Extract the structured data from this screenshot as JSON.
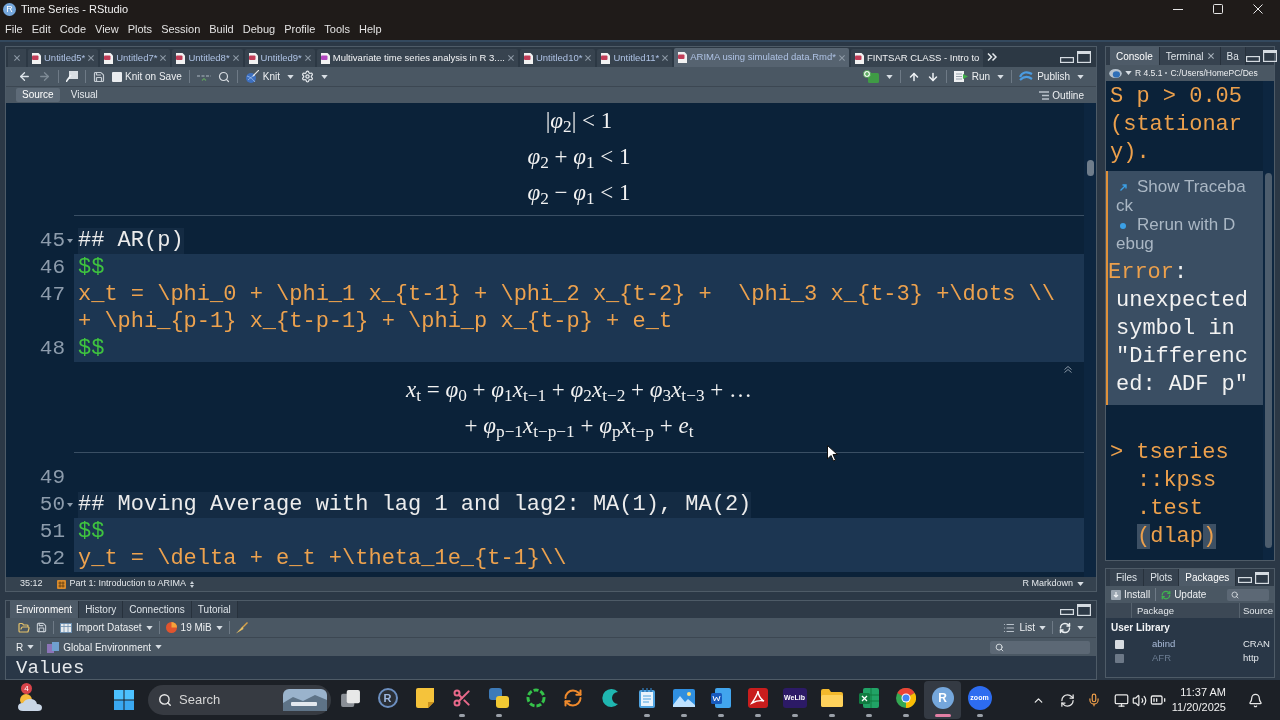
{
  "window": {
    "logo_letter": "R",
    "title": "Time Series - RStudio"
  },
  "menu": [
    "File",
    "Edit",
    "Code",
    "View",
    "Plots",
    "Session",
    "Build",
    "Debug",
    "Profile",
    "Tools",
    "Help"
  ],
  "editor": {
    "tabs": [
      {
        "label": "Untitled5*",
        "kind": "rmd",
        "modified": true,
        "closable": true,
        "selected": false
      },
      {
        "label": "Untitled7*",
        "kind": "rmd",
        "modified": true,
        "closable": true,
        "selected": false
      },
      {
        "label": "Untitled8*",
        "kind": "rmd",
        "modified": true,
        "closable": true,
        "selected": false
      },
      {
        "label": "Untitled9*",
        "kind": "rmd",
        "modified": true,
        "closable": true,
        "selected": false
      },
      {
        "label": "Multivariate time series analysis in R 3....",
        "kind": "other",
        "modified": false,
        "closable": true,
        "selected": false
      },
      {
        "label": "Untitled10*",
        "kind": "rmd",
        "modified": true,
        "closable": true,
        "selected": false
      },
      {
        "label": "Untitled11*",
        "kind": "rmd",
        "modified": true,
        "closable": true,
        "selected": false
      },
      {
        "label": "ARIMA using simulated data.Rmd*",
        "kind": "rmd",
        "modified": true,
        "closable": true,
        "selected": true
      },
      {
        "label": "FINTSAR CLASS - Intro to",
        "kind": "rmd",
        "modified": false,
        "closable": false,
        "selected": false
      }
    ],
    "toolbar": {
      "knit_on_save": {
        "label": "Knit on Save",
        "checked": false
      },
      "knit": "Knit",
      "run": "Run",
      "publish": "Publish"
    },
    "modes": [
      {
        "label": "Source",
        "selected": true
      },
      {
        "label": "Visual",
        "selected": false
      }
    ],
    "outline": "Outline",
    "lines": [
      {
        "kind": "math",
        "rows": [
          "|*φ*$_{2}$| < 1",
          "*φ*$_{2}$ + *φ*$_{1}$ < 1",
          "*φ*$_{2}$ − *φ*$_{1}$ < 1"
        ],
        "collapse_button": false
      },
      {
        "kind": "heading",
        "number": "45",
        "rows": [
          "## AR(p)"
        ],
        "foldable": true
      },
      {
        "kind": "delimiter",
        "number": "46",
        "rows": [
          "$$"
        ]
      },
      {
        "kind": "code",
        "number": "47",
        "rows": [
          "x_t = \\phi_0 + \\phi_1 x_{t-1} + \\phi_2 x_{t-2} +  \\phi_3 x_{t-3} +\\dots \\\\",
          "+ \\phi_{p-1} x_{t-p-1} + \\phi_p x_{t-p} + e_t"
        ]
      },
      {
        "kind": "delimiter",
        "number": "48",
        "rows": [
          "$$"
        ]
      },
      {
        "kind": "math",
        "rows": [
          "*x*$_{t}$ = *φ*$_{0}$ + *φ*$_{1}$*x*$_{t−1}$ + *φ*$_{2}$*x*$_{t−2}$ + *φ*$_{3}$*x*$_{t−3}$ + …",
          "+ *φ*$_{p−1}$*x*$_{t−p−1}$ + *φ*$_{p}$*x*$_{t−p}$ + *e*$_{t}$"
        ],
        "collapse_button": true
      },
      {
        "kind": "blank",
        "number": "49"
      },
      {
        "kind": "heading",
        "number": "50",
        "rows": [
          "## Moving Average with lag 1 and lag2: MA(1), MA(2)"
        ],
        "foldable": true
      },
      {
        "kind": "delimiter",
        "number": "51",
        "rows": [
          "$$"
        ]
      },
      {
        "kind": "code",
        "number": "52",
        "rows": [
          "y_t = \\delta + e_t +\\theta_1e_{t-1}\\\\"
        ]
      }
    ],
    "status": {
      "position": "35:12",
      "section": "Part 1: Introduction to ARIMA",
      "file_type": "R Markdown"
    }
  },
  "environment": {
    "tabs": [
      {
        "label": "Environment",
        "selected": true
      },
      {
        "label": "History",
        "selected": false
      },
      {
        "label": "Connections",
        "selected": false
      },
      {
        "label": "Tutorial",
        "selected": false
      }
    ],
    "toolbar": {
      "import": "Import Dataset",
      "memory": "19 MiB",
      "view": "List"
    },
    "language": "R",
    "scope": "Global Environment",
    "section": "Values"
  },
  "console": {
    "tabs": [
      {
        "label": "Console",
        "selected": true,
        "closable": false
      },
      {
        "label": "Terminal",
        "selected": false,
        "closable": true
      },
      {
        "label": "Ba",
        "selected": false,
        "closable": false
      }
    ],
    "version": "R 4.5.1",
    "path": "C:/Users/HomePC/Des",
    "output_rows": [
      "S p > 0.05",
      "(stationar",
      "y)."
    ],
    "error": {
      "actions": [
        {
          "kind": "traceback",
          "label_rows": [
            "Show Traceba",
            "ck"
          ]
        },
        {
          "kind": "debug",
          "label_rows": [
            "Rerun with D",
            "ebug"
          ]
        }
      ],
      "label": "Error",
      "separator": ":",
      "message_rows": [
        "unexpected",
        "symbol in",
        "\"Differenc",
        "ed: ADF p\""
      ]
    },
    "prompt": ">",
    "input_rows": [
      [
        {
          "text": "tseries",
          "highlight": false
        }
      ],
      [
        {
          "text": "::kpss",
          "highlight": false
        }
      ],
      [
        {
          "text": ".test",
          "highlight": false
        }
      ],
      [
        {
          "text": "(",
          "highlight": true
        },
        {
          "text": "dlap",
          "highlight": false
        },
        {
          "text": ")",
          "highlight": true
        }
      ]
    ]
  },
  "packages": {
    "tabs": [
      {
        "label": "Files",
        "selected": false
      },
      {
        "label": "Plots",
        "selected": false
      },
      {
        "label": "Packages",
        "selected": true
      }
    ],
    "toolbar": {
      "install": "Install",
      "update": "Update"
    },
    "columns": [
      "Package",
      "Source"
    ],
    "group": "User Library",
    "rows": [
      {
        "name": "abind",
        "source": "CRAN",
        "checked": false
      },
      {
        "name": "AFR",
        "source": "http",
        "checked": false
      }
    ]
  },
  "taskbar": {
    "weather_badge": "4",
    "search": {
      "placeholder": "Search"
    },
    "apps": [
      {
        "kind": "task-view",
        "running": false,
        "selected": false
      },
      {
        "kind": "r-console",
        "label": "R",
        "running": false,
        "selected": false
      },
      {
        "kind": "sticky-notes",
        "running": false,
        "selected": false
      },
      {
        "kind": "snipping",
        "running": true,
        "selected": false
      },
      {
        "kind": "python",
        "running": true,
        "selected": false
      },
      {
        "kind": "ring",
        "running": false,
        "selected": false
      },
      {
        "kind": "arrows",
        "running": false,
        "selected": false
      },
      {
        "kind": "crescent",
        "running": false,
        "selected": false
      },
      {
        "kind": "notepad",
        "running": true,
        "selected": false
      },
      {
        "kind": "photos",
        "running": true,
        "selected": false
      },
      {
        "kind": "word",
        "running": true,
        "selected": false
      },
      {
        "kind": "acrobat",
        "running": true,
        "selected": false
      },
      {
        "kind": "welib",
        "label": "WeLib",
        "running": true,
        "selected": false
      },
      {
        "kind": "folder",
        "running": true,
        "selected": false
      },
      {
        "kind": "excel",
        "running": true,
        "selected": false
      },
      {
        "kind": "chrome",
        "running": true,
        "selected": false
      },
      {
        "kind": "rstudio",
        "label": "R",
        "running": true,
        "selected": true
      },
      {
        "kind": "zoom",
        "label": "zoom",
        "running": true,
        "selected": false
      }
    ],
    "time": "11:37 AM",
    "date": "11/20/2025"
  }
}
